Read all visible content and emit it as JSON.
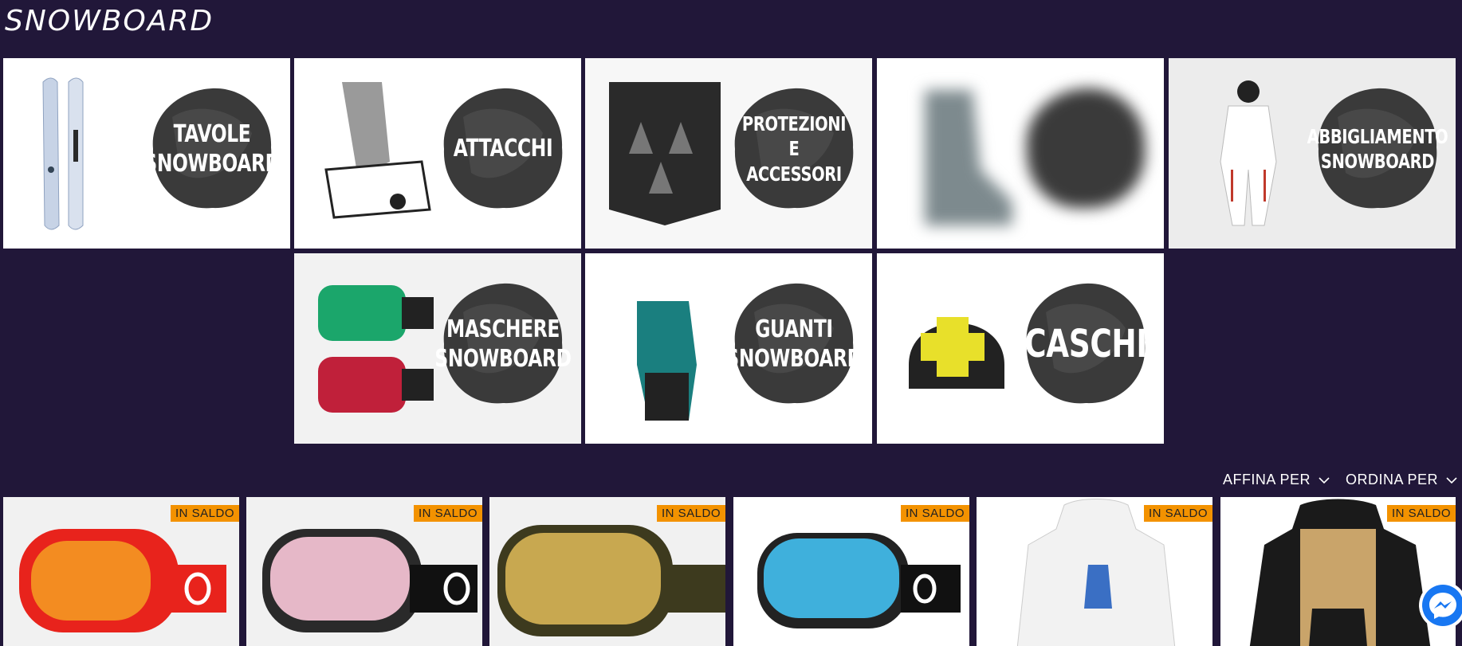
{
  "page": {
    "title": "SNOWBOARD"
  },
  "categories": [
    {
      "label": "TAVOLE\nSNOWBOARD"
    },
    {
      "label": "ATTACCHI"
    },
    {
      "label": "PROTEZIONI\nE ACCESSORI"
    },
    {
      "label": ""
    },
    {
      "label": "ABBIGLIAMENTO\nSNOWBOARD"
    },
    {
      "label": "MASCHERE\nSNOWBOARD"
    },
    {
      "label": "GUANTI\nSNOWBOARD"
    },
    {
      "label": "CASCHI"
    }
  ],
  "toolbar": {
    "filter_label": "AFFINA PER",
    "sort_label": "ORDINA PER"
  },
  "products": [
    {
      "badge": "IN SALDO",
      "icon": "goggle-red"
    },
    {
      "badge": "IN SALDO",
      "icon": "goggle-pink"
    },
    {
      "badge": "IN SALDO",
      "icon": "goggle-gold"
    },
    {
      "badge": "IN SALDO",
      "icon": "goggle-blue"
    },
    {
      "badge": "IN SALDO",
      "icon": "hoodie-white"
    },
    {
      "badge": "IN SALDO",
      "icon": "hoodie-black-tan"
    }
  ],
  "colors": {
    "background": "#211739",
    "sale_badge": "#f39200",
    "messenger": "#1877f2"
  }
}
